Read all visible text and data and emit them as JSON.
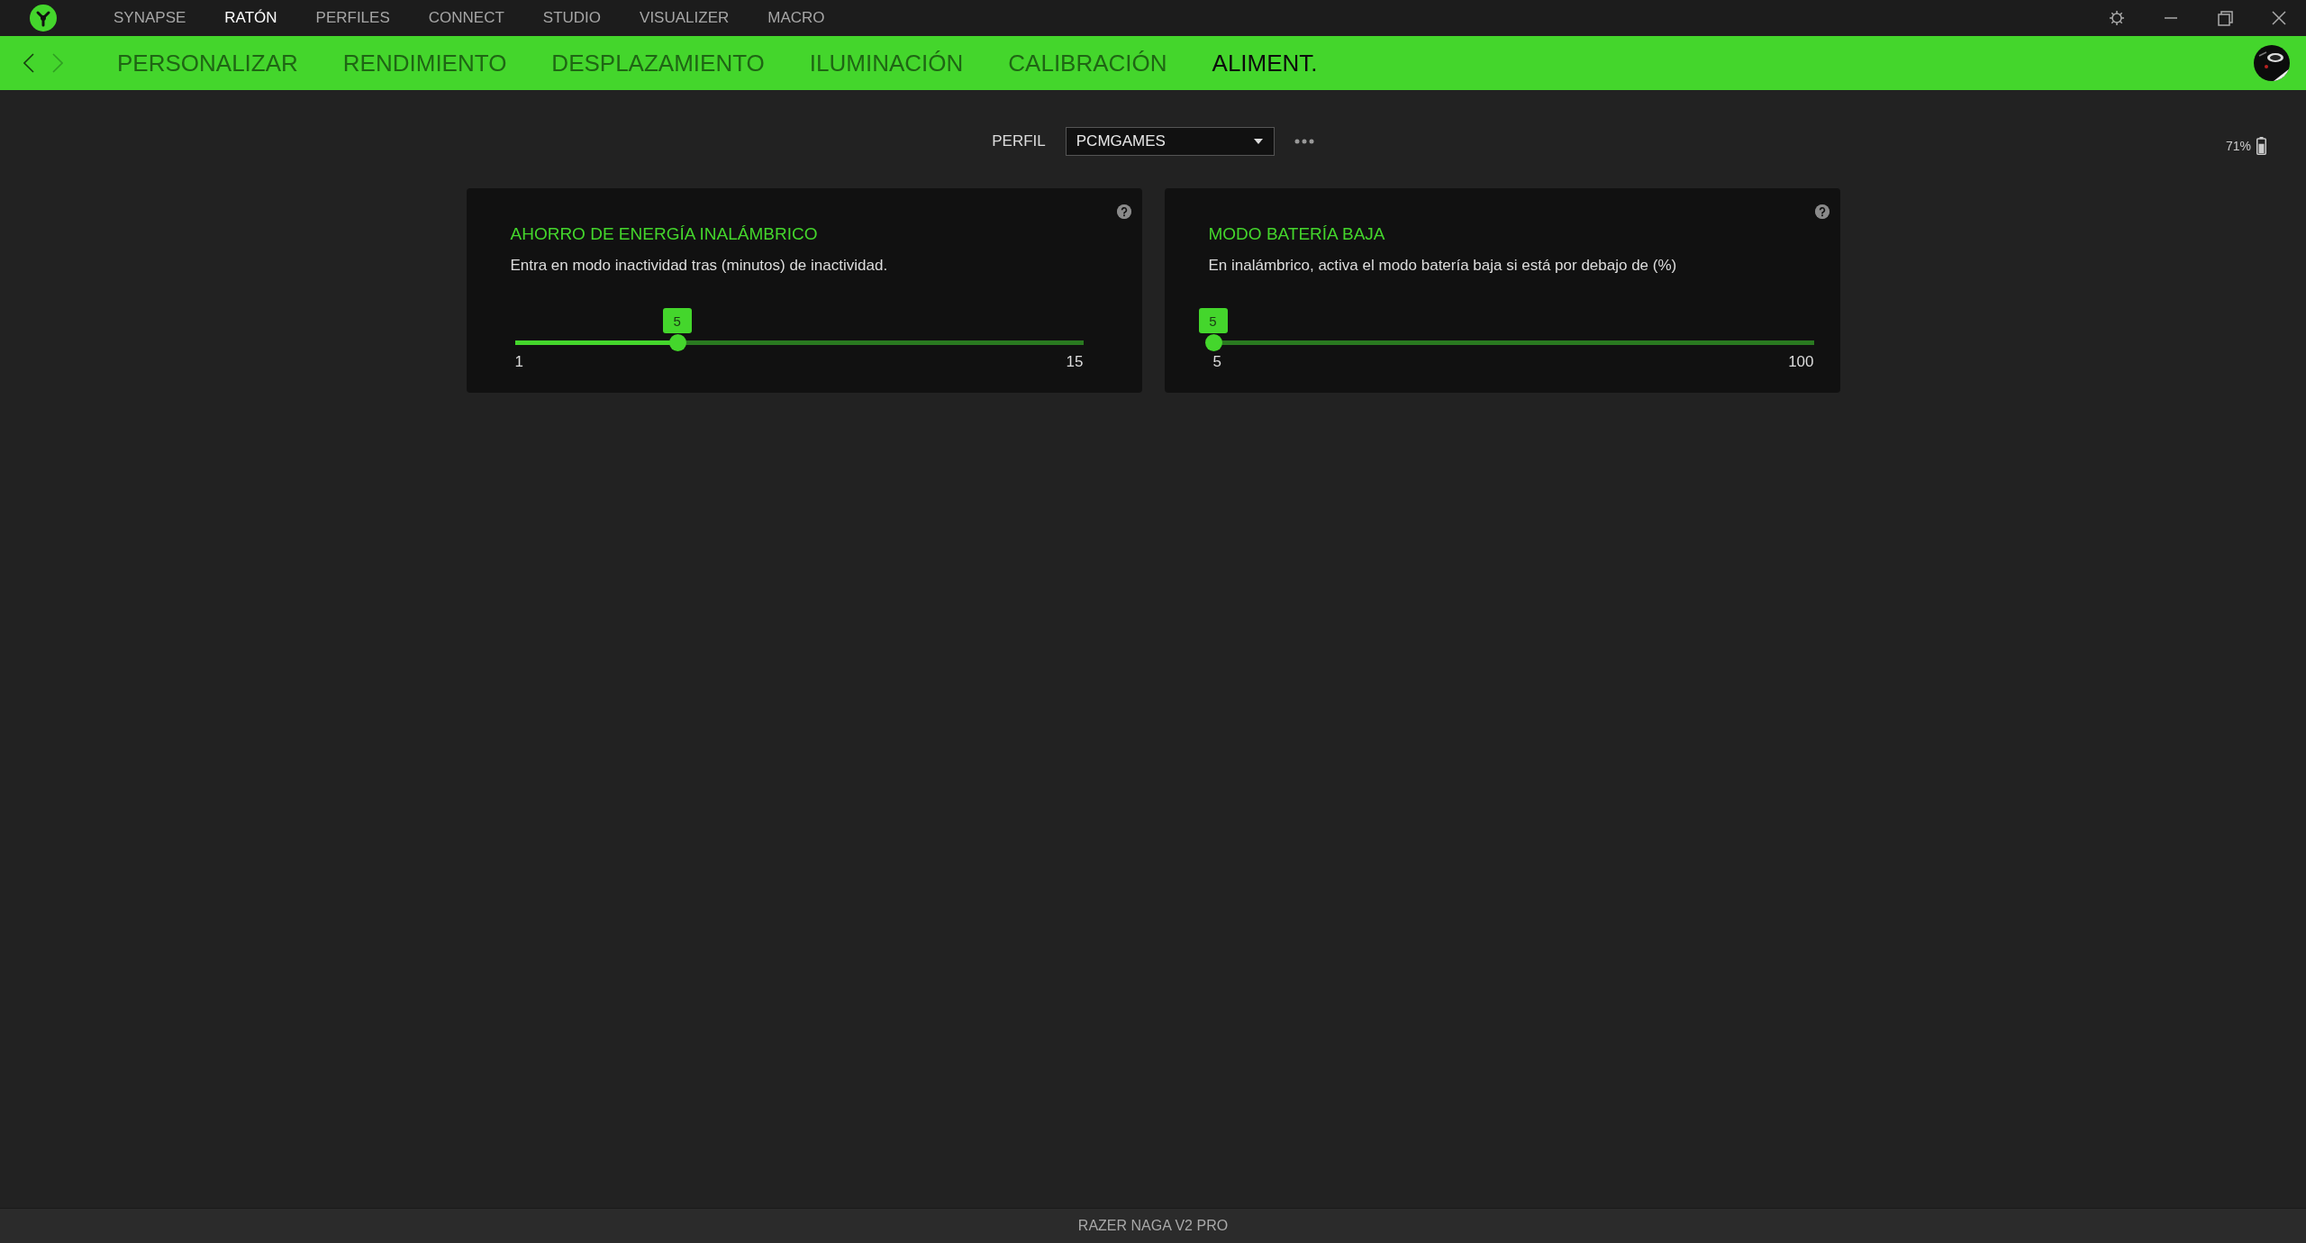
{
  "top_tabs": [
    {
      "label": "SYNAPSE",
      "selected": false
    },
    {
      "label": "RATÓN",
      "selected": true
    },
    {
      "label": "PERFILES",
      "selected": false
    },
    {
      "label": "CONNECT",
      "selected": false
    },
    {
      "label": "STUDIO",
      "selected": false
    },
    {
      "label": "VISUALIZER",
      "selected": false
    },
    {
      "label": "MACRO",
      "selected": false
    }
  ],
  "history": {
    "back_disabled": false,
    "forward_disabled": true
  },
  "sub_tabs": [
    {
      "label": "PERSONALIZAR",
      "selected": false
    },
    {
      "label": "RENDIMIENTO",
      "selected": false
    },
    {
      "label": "DESPLAZAMIENTO",
      "selected": false
    },
    {
      "label": "ILUMINACIÓN",
      "selected": false
    },
    {
      "label": "CALIBRACIÓN",
      "selected": false
    },
    {
      "label": "ALIMENT.",
      "selected": true
    }
  ],
  "profile": {
    "label": "PERFIL",
    "value": "PCMGAMES"
  },
  "battery": {
    "reading": "71%",
    "level": 0.71
  },
  "cards": [
    {
      "title": "AHORRO DE ENERGÍA INALÁMBRICO",
      "description": "Entra en modo inactividad tras (minutos) de inactividad.",
      "slider": {
        "value": "5",
        "min": "1",
        "max": "15",
        "level": 0.2857
      }
    },
    {
      "title": "MODO BATERÍA BAJA",
      "description": "En inalámbrico, activa el modo batería baja si está por debajo de (%)",
      "slider": {
        "value": "5",
        "min": "5",
        "max": "100",
        "level": 0
      }
    }
  ],
  "status_bar": {
    "device": "RAZER NAGA V2 PRO"
  }
}
